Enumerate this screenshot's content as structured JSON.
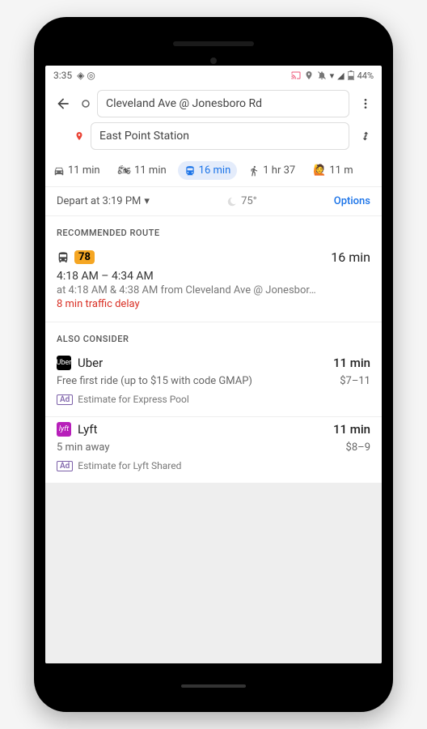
{
  "status": {
    "time": "3:35",
    "battery": "44%"
  },
  "inputs": {
    "origin": "Cleveland Ave @ Jonesboro Rd",
    "destination": "East Point Station"
  },
  "modes": {
    "car": "11 min",
    "motorcycle": "11 min",
    "transit": "16 min",
    "walk": "1 hr 37",
    "rideshare": "11 m"
  },
  "depart": {
    "label": "Depart at 3:19 PM",
    "temp": "75°",
    "options": "Options"
  },
  "recommended": {
    "title": "RECOMMENDED ROUTE",
    "busNumber": "78",
    "duration": "16 min",
    "timeRange": "4:18 AM – 4:34 AM",
    "detail": "at 4:18 AM & 4:38 AM from Cleveland Ave @ Jonesbor…",
    "delay": "8 min traffic delay"
  },
  "consider": {
    "title": "ALSO CONSIDER",
    "options": [
      {
        "brand": "Uber",
        "brandBg": "#000000",
        "brandText": "Uber",
        "duration": "11 min",
        "sub": "Free first ride (up to $15 with code GMAP)",
        "price": "$7–11",
        "adText": "Estimate for Express Pool"
      },
      {
        "brand": "Lyft",
        "brandBg": "#b71fba",
        "brandText": "lyft",
        "duration": "11 min",
        "sub": "5 min away",
        "price": "$8–9",
        "adText": "Estimate for Lyft Shared"
      }
    ]
  },
  "adLabel": "Ad"
}
